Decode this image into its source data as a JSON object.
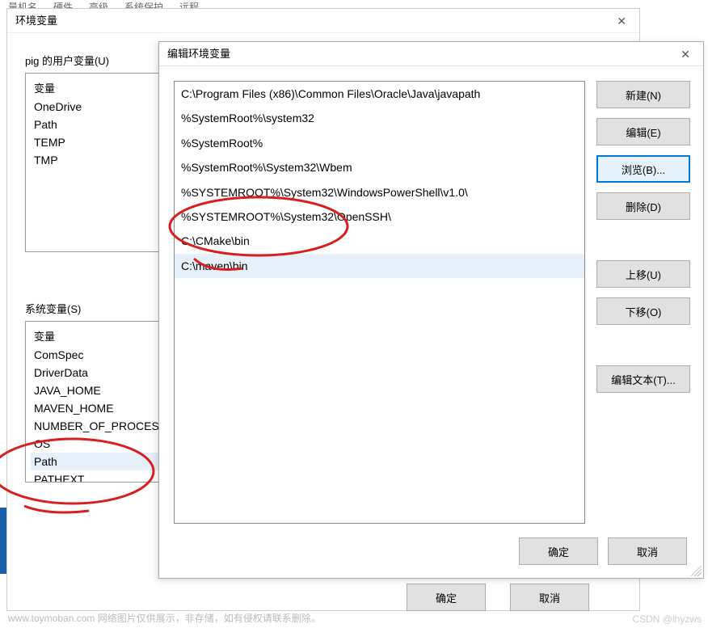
{
  "top_tabs": [
    "量机名",
    "硬件",
    "高级",
    "系统保护",
    "远程"
  ],
  "parent_dialog": {
    "title": "环境变量",
    "close": "✕",
    "user_section_label": "pig 的用户变量(U)",
    "system_section_label": "系统变量(S)",
    "col_header": "变量",
    "user_vars": [
      "OneDrive",
      "Path",
      "TEMP",
      "TMP"
    ],
    "system_vars": [
      "ComSpec",
      "DriverData",
      "JAVA_HOME",
      "MAVEN_HOME",
      "NUMBER_OF_PROCES",
      "OS",
      "Path",
      "PATHEXT"
    ],
    "ok": "确定",
    "cancel": "取消"
  },
  "edit_dialog": {
    "title": "编辑环境变量",
    "close": "✕",
    "paths": [
      "C:\\Program Files (x86)\\Common Files\\Oracle\\Java\\javapath",
      "%SystemRoot%\\system32",
      "%SystemRoot%",
      "%SystemRoot%\\System32\\Wbem",
      "%SYSTEMROOT%\\System32\\WindowsPowerShell\\v1.0\\",
      "%SYSTEMROOT%\\System32\\OpenSSH\\",
      "C:\\CMake\\bin",
      "C:\\maven\\bin"
    ],
    "selected_index": 7,
    "buttons": {
      "new": "新建(N)",
      "edit": "编辑(E)",
      "browse": "浏览(B)...",
      "delete": "删除(D)",
      "move_up": "上移(U)",
      "move_down": "下移(O)",
      "edit_text": "编辑文本(T)..."
    },
    "ok": "确定",
    "cancel": "取消"
  },
  "watermark_left": "www.toymoban.com  网络图片仅供展示，非存储，如有侵权请联系删除。",
  "watermark_right": "CSDN @lhyzws"
}
